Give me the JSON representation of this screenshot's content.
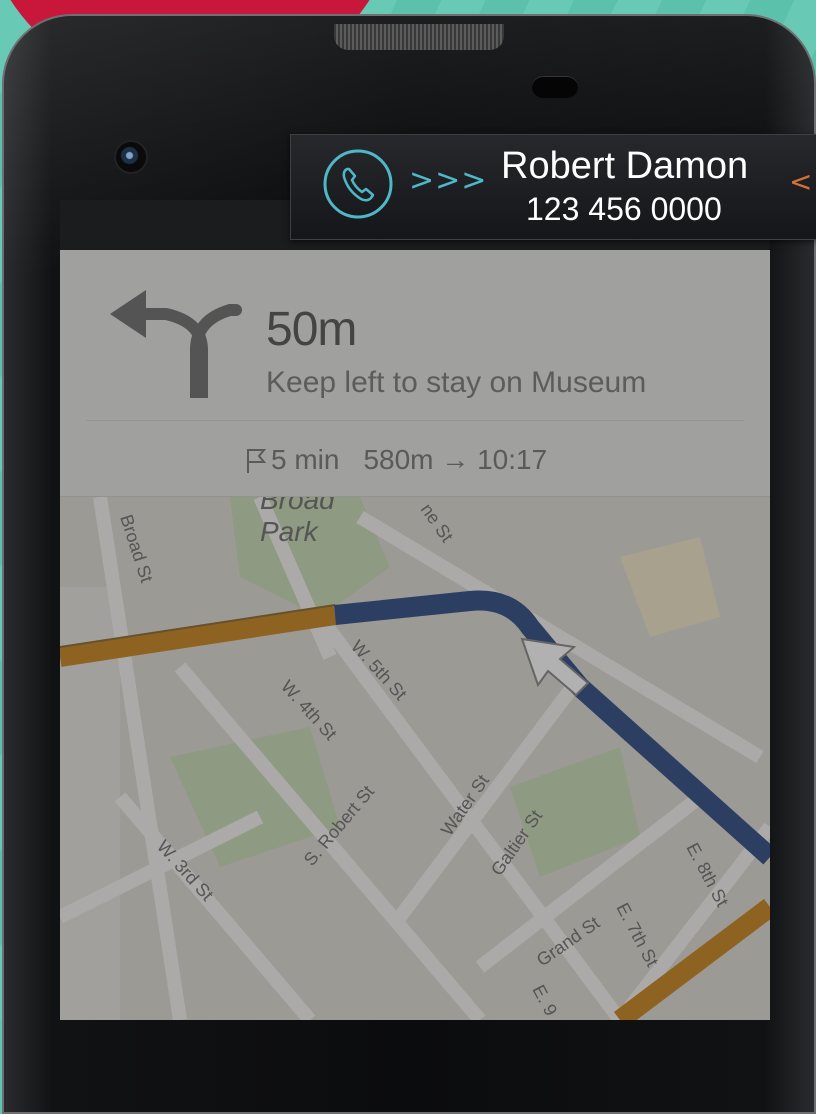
{
  "call": {
    "caller_name": "Robert Damon",
    "caller_number": "123 456 0000",
    "accept_hint": ">>>",
    "reject_hint": "<<",
    "accent_color": "#4fb8c8"
  },
  "navigation": {
    "distance": "50m",
    "instruction": "Keep left to stay on Museum",
    "eta_time": "5 min",
    "remaining": "580m → 10:17"
  },
  "map": {
    "park_name_top": "Broad",
    "park_name_bottom": "Park",
    "streets": [
      "Broad St",
      "ne St",
      "W. 5th St",
      "W. 4th St",
      "S. Robert St",
      "Water St",
      "Galtier St",
      "W. 3rd St",
      "Grand St",
      "E. 7th St",
      "E. 8th St",
      "E. 9"
    ],
    "route_color": "#2f4e86",
    "traffic_color": "#c8841e"
  },
  "icons": {
    "phone": "phone-icon",
    "turn": "keep-left-arrow-icon",
    "flag": "destination-flag-icon",
    "nav_arrow": "navigation-arrow-icon"
  }
}
